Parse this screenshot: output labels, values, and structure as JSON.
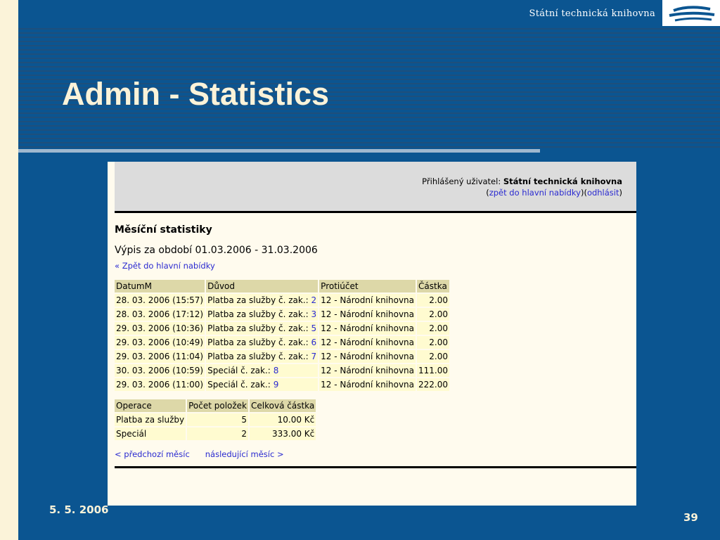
{
  "header": {
    "organization": "Státní technická knihovna",
    "logo_icon": "stk-logo-icon"
  },
  "slide": {
    "title": "Admin - Statistics",
    "date": "5. 5. 2006",
    "page_number": "39"
  },
  "app": {
    "logged_label": "Přihlášený uživatel:",
    "logged_user": "Státní technická knihovna",
    "nav_open": "(",
    "nav_back_main": "zpět do hlavní nabídky",
    "nav_between": ")(",
    "nav_logout": "odhlásit",
    "nav_close": ")",
    "heading": "Měsíční statistiky",
    "period_text": "Výpis za období 01.03.2006 - 31.03.2006",
    "back_link": "« Zpět do hlavní nabídky",
    "transactions": {
      "columns": [
        "DatumM",
        "Důvod",
        "Protiúčet",
        "Částka"
      ],
      "rows": [
        {
          "date": "28. 03. 2006 (15:57)",
          "reason": "Platba za služby č. zak.:",
          "order": "2",
          "account": "12 - Národní knihovna",
          "amount": "2.00"
        },
        {
          "date": "28. 03. 2006 (17:12)",
          "reason": "Platba za služby č. zak.:",
          "order": "3",
          "account": "12 - Národní knihovna",
          "amount": "2.00"
        },
        {
          "date": "29. 03. 2006 (10:36)",
          "reason": "Platba za služby č. zak.:",
          "order": "5",
          "account": "12 - Národní knihovna",
          "amount": "2.00"
        },
        {
          "date": "29. 03. 2006 (10:49)",
          "reason": "Platba za služby č. zak.:",
          "order": "6",
          "account": "12 - Národní knihovna",
          "amount": "2.00"
        },
        {
          "date": "29. 03. 2006 (11:04)",
          "reason": "Platba za služby č. zak.:",
          "order": "7",
          "account": "12 - Národní knihovna",
          "amount": "2.00"
        },
        {
          "date": "30. 03. 2006 (10:59)",
          "reason": "Speciál č. zak.:",
          "order": "8",
          "account": "12 - Národní knihovna",
          "amount": "111.00"
        },
        {
          "date": "29. 03. 2006 (11:00)",
          "reason": "Speciál č. zak.:",
          "order": "9",
          "account": "12 - Národní knihovna",
          "amount": "222.00"
        }
      ]
    },
    "summary": {
      "columns": [
        "Operace",
        "Počet položek",
        "Celková částka"
      ],
      "rows": [
        {
          "operation": "Platba za služby",
          "count": "5",
          "total": "10.00 Kč"
        },
        {
          "operation": "Speciál",
          "count": "2",
          "total": "333.00 Kč"
        }
      ]
    },
    "prev_month": "< předchozí měsíc",
    "next_month": "následující měsíc >"
  }
}
